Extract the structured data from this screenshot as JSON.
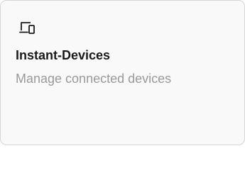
{
  "card": {
    "icon": "devices-icon",
    "title": "Instant-Devices",
    "description": "Manage connected devices"
  },
  "colors": {
    "card_background": "#f9f9f9",
    "card_border": "#d6d6d6",
    "title_text": "#1a1a1a",
    "description_text": "#9a9a9a"
  }
}
